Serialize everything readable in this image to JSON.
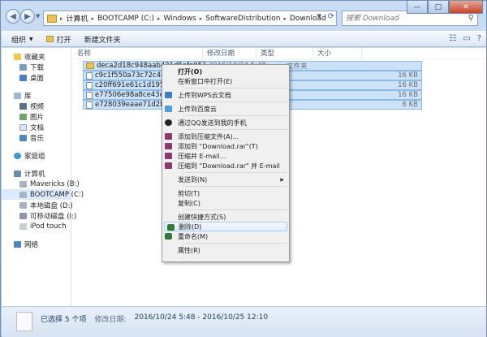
{
  "address": {
    "crumbs": [
      "计算机",
      "BOOTCAMP (C:)",
      "Windows",
      "SoftwareDistribution",
      "Download"
    ]
  },
  "search": {
    "placeholder": "搜索 Download"
  },
  "toolbar": {
    "organize": "组织",
    "open": "打开",
    "new_folder": "新建文件夹"
  },
  "columns": {
    "name": "名称",
    "date": "修改日期",
    "type": "类型",
    "size": "大小"
  },
  "sidebar": {
    "favorites": "收藏夹",
    "downloads": "下载",
    "desktop": "桌面",
    "libraries": "库",
    "videos": "视频",
    "pictures": "图片",
    "documents": "文档",
    "music": "音乐",
    "homegroup": "家庭组",
    "computer": "计算机",
    "drive_b": "Mavericks (B:)",
    "drive_c": "BOOTCAMP (C:)",
    "drive_d": "本地磁盘 (D:)",
    "drive_i": "可移动磁盘 (I:)",
    "ipod": "iPod touch",
    "network": "网络"
  },
  "files": [
    {
      "name": "deca2d18c948aab421d5afe057c188aa",
      "date": "2016/10/24 5:48",
      "type": "文件夹",
      "size": "",
      "folder": true
    },
    {
      "name": "c9c1f550a73c72c48a98293",
      "date": "",
      "type": "",
      "size": "16 KB",
      "folder": false
    },
    {
      "name": "c20ff691e61c1d19556f37",
      "date": "",
      "type": "",
      "size": "16 KB",
      "folder": false
    },
    {
      "name": "e77506e98a8ce43e073f1",
      "date": "",
      "type": "",
      "size": "16 KB",
      "folder": false
    },
    {
      "name": "e728039eaae71d2b0e66",
      "date": "",
      "type": "",
      "size": "6 KB",
      "folder": false
    }
  ],
  "context_menu": {
    "open": "打开(O)",
    "open_new_window": "在新窗口中打开(E)",
    "upload_wps": "上传到WPS云文档",
    "upload_baidu": "上传到百度云",
    "send_qq": "通过QQ发送到我的手机",
    "add_archive": "添加到压缩文件(A)...",
    "add_rar": "添加到 \"Download.rar\"(T)",
    "compress_email": "压缩并 E-mail...",
    "compress_rar_email": "压缩到 \"Download.rar\" 并 E-mail",
    "send_to": "发送到(N)",
    "cut": "剪切(T)",
    "copy": "复制(C)",
    "shortcut": "创建快捷方式(S)",
    "delete": "删除(D)",
    "rename": "重命名(M)",
    "properties": "属性(R)"
  },
  "status": {
    "selected": "已选择 5 个项",
    "modified_label": "修改日期:",
    "modified_range": "2016/10/24 5:48 - 2016/10/25 12:10"
  },
  "colors": {
    "selection": "#cce2f9",
    "accent": "#3a6ab0"
  }
}
